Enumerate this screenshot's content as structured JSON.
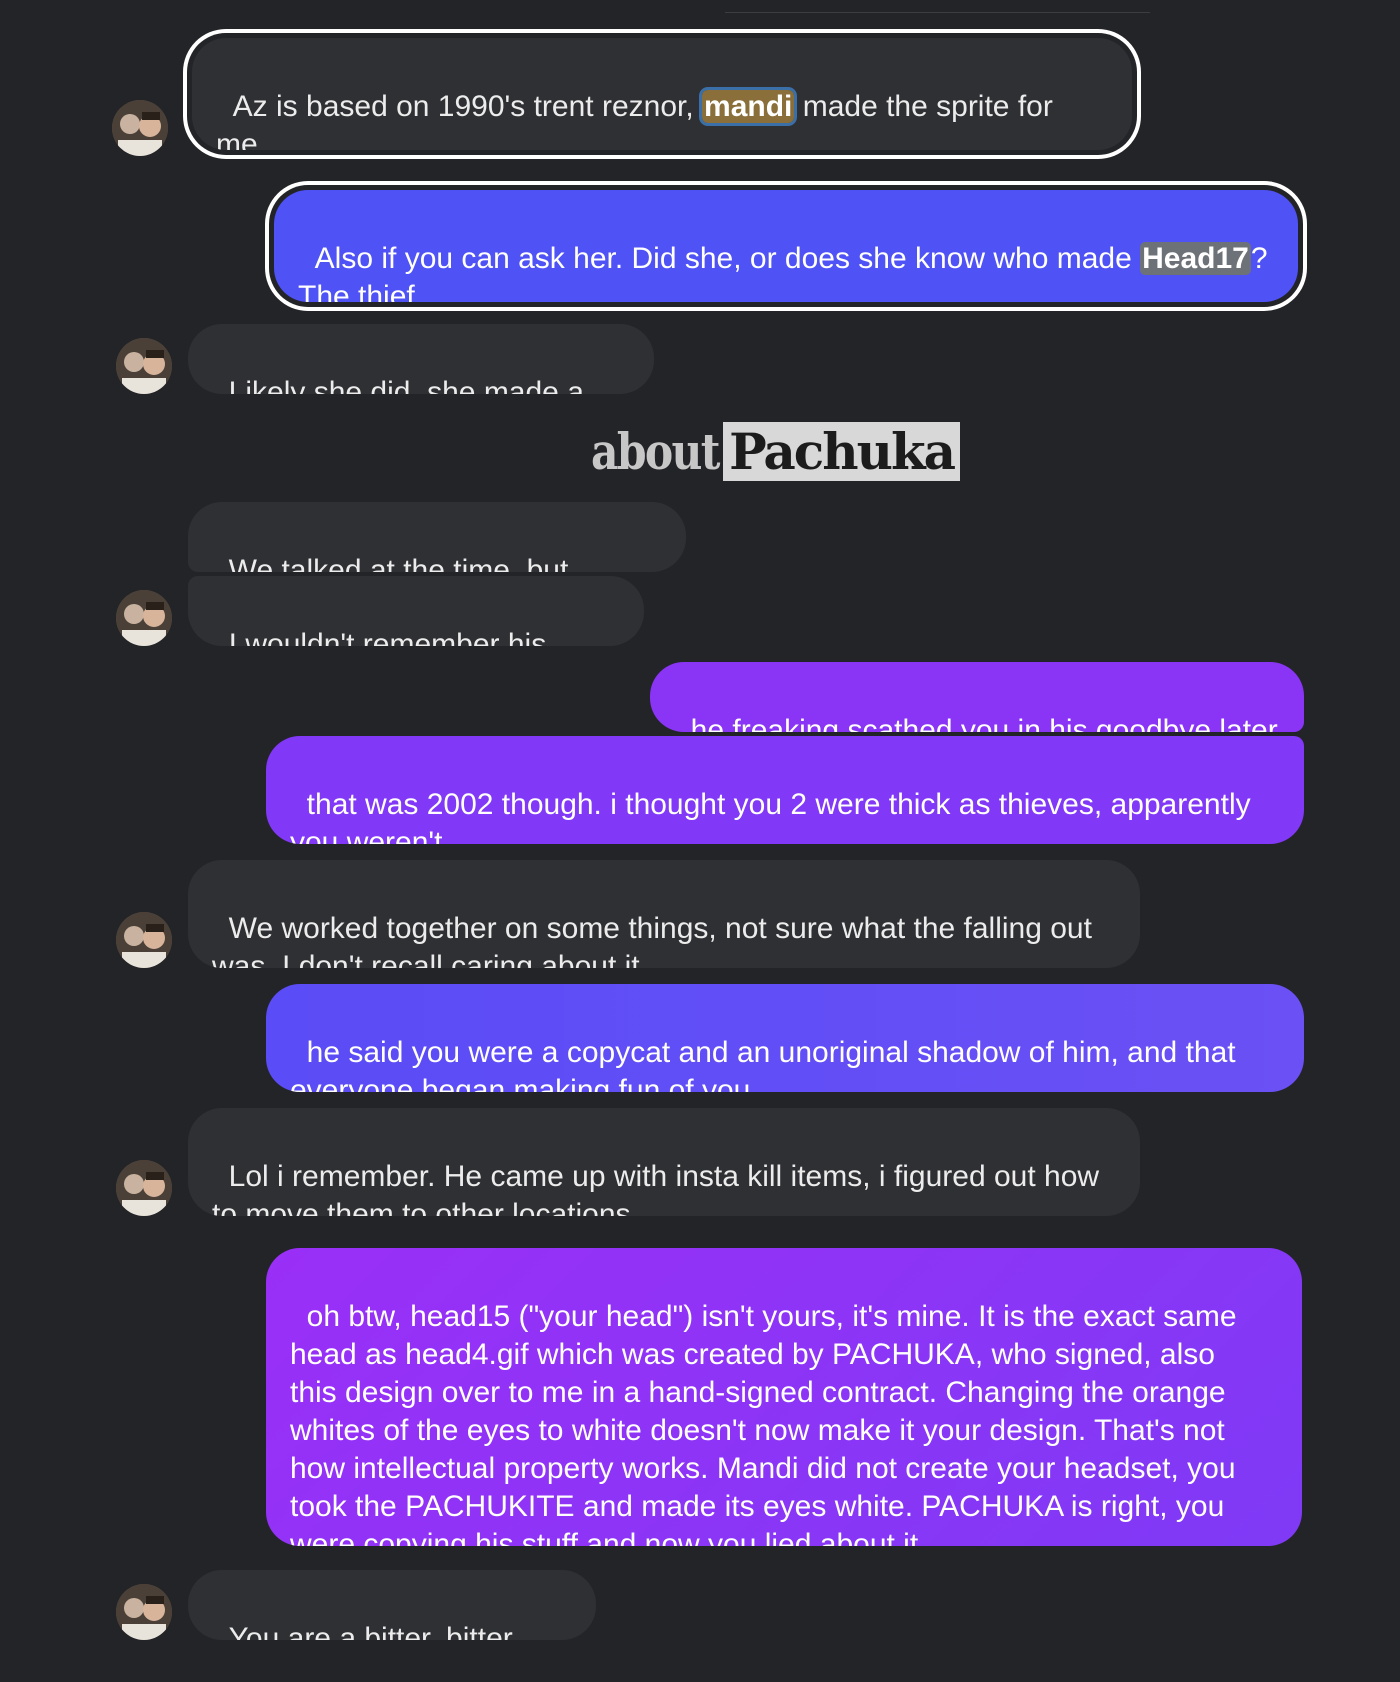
{
  "colors": {
    "background": "#232427",
    "incoming_bubble": "#2f3033",
    "outgoing_blue": "#4f52f5",
    "outgoing_purple": "#8a32f7",
    "selection_ring": "#ffffff"
  },
  "logo": {
    "left_text": "about",
    "right_text": "Pachuka"
  },
  "messages": [
    {
      "sender": "them",
      "pre": "Az is based on 1990's trent reznor, ",
      "hl": "mandi",
      "post": " made the sprite for\nme"
    },
    {
      "sender": "me",
      "pre": "Also if you can ask her. Did she, or does she know who made ",
      "hl": "Head17",
      "post": "?\nThe thief"
    },
    {
      "sender": "them",
      "text": "Likely she did, she made a few"
    },
    {
      "sender": "them",
      "text": "We talked at the time, but barely."
    },
    {
      "sender": "them",
      "text": "I wouldn't remember his voice"
    },
    {
      "sender": "me",
      "text": "he freaking scathed you in his goodbye later"
    },
    {
      "sender": "me",
      "text": "that was 2002 though. i thought you 2 were thick as thieves, apparently\nyou weren't."
    },
    {
      "sender": "them",
      "text": "We worked together on some things, not sure what the falling out\nwas. I don't recall caring about it"
    },
    {
      "sender": "me",
      "text": "he said you were a copycat and an unoriginal shadow of him, and that\neveryone began making fun of you."
    },
    {
      "sender": "them",
      "text": "Lol i remember. He came up with insta kill items, i figured out how\nto move them to other locations"
    },
    {
      "sender": "me",
      "text": "oh btw, head15 (\"your head\") isn't yours, it's mine. It is the exact same\nhead as head4.gif which was created by PACHUKA, who signed, also\nthis design over to me in a hand-signed contract. Changing the orange\nwhites of the eyes to white doesn't now make it your design. That's not\nhow intellectual property works. Mandi did not create your headset, you\ntook the PACHUKITE and made its eyes white. PACHUKA is right, you\nwere copying his stuff and now you lied about it"
    },
    {
      "sender": "them",
      "text": "You are a bitter, bitter guy."
    }
  ]
}
